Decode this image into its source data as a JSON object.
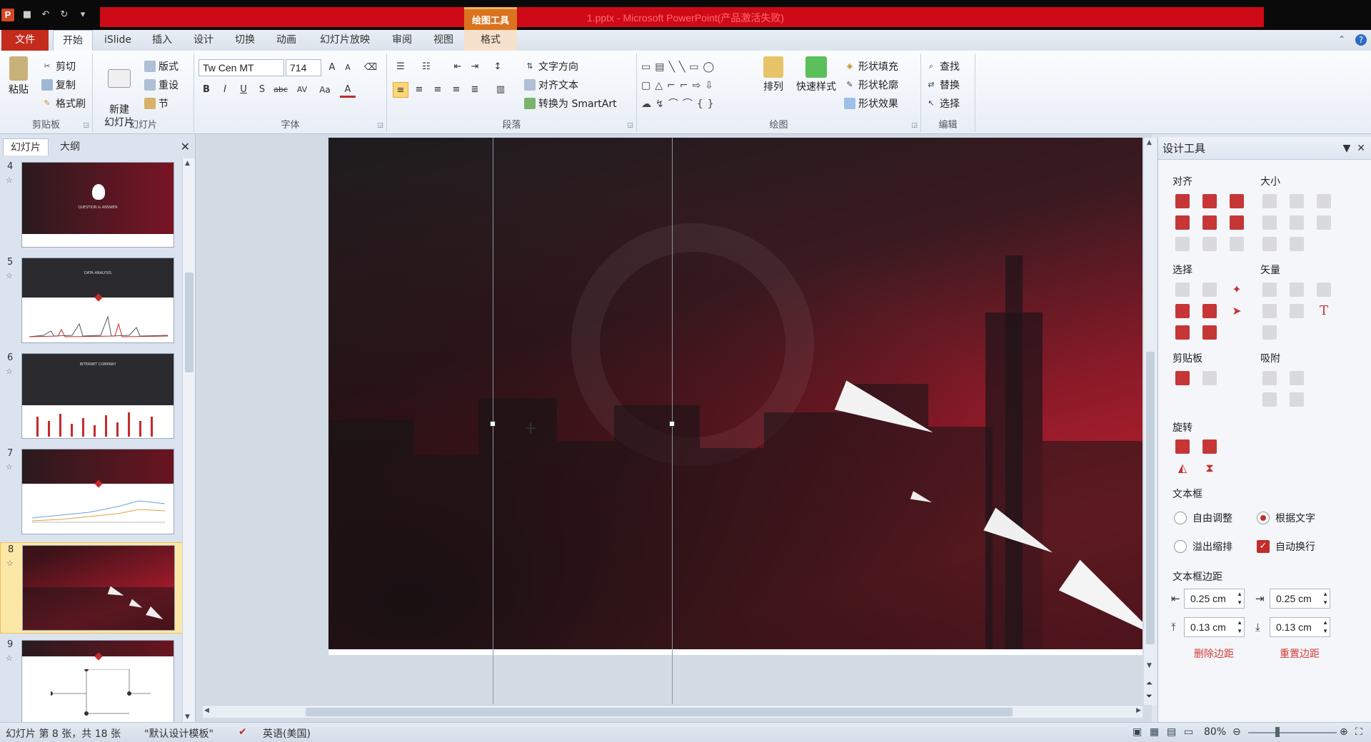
{
  "titlebar": {
    "app_icon": "P",
    "title": "1.pptx - Microsoft PowerPoint(产品激活失败)",
    "context_group": "绘图工具"
  },
  "tabs": {
    "file": "文件",
    "home": "开始",
    "islide": "iSlide",
    "insert": "插入",
    "design": "设计",
    "transitions": "切换",
    "animations": "动画",
    "slideshow": "幻灯片放映",
    "review": "审阅",
    "view": "视图",
    "format": "格式"
  },
  "ribbon": {
    "clipboard": {
      "label": "剪贴板",
      "paste": "粘贴",
      "cut": "剪切",
      "copy": "复制",
      "format_painter": "格式刷"
    },
    "slides": {
      "label": "幻灯片",
      "new_slide": "新建\n幻灯片",
      "layout": "版式",
      "reset": "重设",
      "section": "节"
    },
    "font": {
      "label": "字体",
      "font_name": "Tw Cen MT",
      "font_size": "714"
    },
    "paragraph": {
      "label": "段落",
      "text_direction": "文字方向",
      "align_text": "对齐文本",
      "smartart": "转换为 SmartArt"
    },
    "drawing": {
      "label": "绘图",
      "arrange": "排列",
      "quick_styles": "快速样式",
      "shape_fill": "形状填充",
      "shape_outline": "形状轮廓",
      "shape_effects": "形状效果"
    },
    "editing": {
      "label": "编辑",
      "find": "查找",
      "replace": "替换",
      "select": "选择"
    }
  },
  "left_pane": {
    "tab_slides": "幻灯片",
    "tab_outline": "大纲",
    "thumbnails": [
      {
        "num": "4",
        "caption": "QUESTION & ANSWER"
      },
      {
        "num": "5",
        "caption": "DATA ANALYSIS"
      },
      {
        "num": "6",
        "caption": "INTERNET COMPANY"
      },
      {
        "num": "7",
        "caption": ""
      },
      {
        "num": "8",
        "caption": ""
      },
      {
        "num": "9",
        "caption": ""
      }
    ]
  },
  "design_pane": {
    "title": "设计工具",
    "sections": {
      "align": "对齐",
      "size": "大小",
      "select": "选择",
      "vector": "矢量",
      "clipboard": "剪贴板",
      "snap": "吸附",
      "rotate": "旋转",
      "textbox": "文本框",
      "margins": "文本框边距"
    },
    "textbox_options": {
      "autofit": "自由调整",
      "fit_text": "根据文字",
      "overflow": "溢出缩排",
      "wrap": "自动换行"
    },
    "margins": {
      "left": "0.25 cm",
      "right": "0.25 cm",
      "top": "0.13 cm",
      "bottom": "0.13 cm"
    },
    "delete_margins": "删除边距",
    "reset_margins": "重置边距"
  },
  "status": {
    "slide_info": "幻灯片 第 8 张，共 18 张",
    "theme": "\"默认设计模板\"",
    "language": "英语(美国)",
    "zoom": "80%"
  },
  "colors": {
    "accent": "#c42b2b",
    "titlebar_red": "#cf0a17"
  }
}
